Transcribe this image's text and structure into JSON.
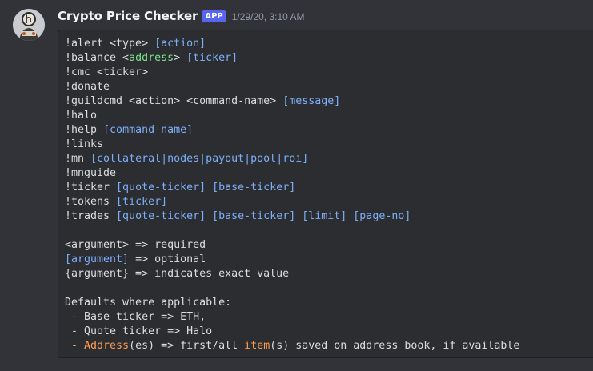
{
  "message": {
    "username": "Crypto Price Checker",
    "badge": "APP",
    "timestamp": "1/29/20, 3:10 AM",
    "avatar": "bot-avatar-icon"
  },
  "colors": {
    "background": "#313338",
    "code_background": "#2b2d31",
    "badge": "#5865f2",
    "token_blue": "#7daef7",
    "token_green": "#7ce38b",
    "token_orange": "#ff9c50"
  },
  "code_lines": [
    [
      {
        "t": "!alert <type> ",
        "c": "plain"
      },
      {
        "t": "[action]",
        "c": "blue"
      }
    ],
    [
      {
        "t": "!balance <",
        "c": "plain"
      },
      {
        "t": "address",
        "c": "green"
      },
      {
        "t": "> ",
        "c": "plain"
      },
      {
        "t": "[ticker]",
        "c": "blue"
      }
    ],
    [
      {
        "t": "!cmc <ticker>",
        "c": "plain"
      }
    ],
    [
      {
        "t": "!donate",
        "c": "plain"
      }
    ],
    [
      {
        "t": "!guildcmd <action> <command-name> ",
        "c": "plain"
      },
      {
        "t": "[message]",
        "c": "blue"
      }
    ],
    [
      {
        "t": "!halo",
        "c": "plain"
      }
    ],
    [
      {
        "t": "!help ",
        "c": "plain"
      },
      {
        "t": "[command-name]",
        "c": "blue"
      }
    ],
    [
      {
        "t": "!links",
        "c": "plain"
      }
    ],
    [
      {
        "t": "!mn ",
        "c": "plain"
      },
      {
        "t": "[collateral|nodes|payout|pool|roi]",
        "c": "blue"
      }
    ],
    [
      {
        "t": "!mnguide",
        "c": "plain"
      }
    ],
    [
      {
        "t": "!ticker ",
        "c": "plain"
      },
      {
        "t": "[quote-ticker]",
        "c": "blue"
      },
      {
        "t": " ",
        "c": "plain"
      },
      {
        "t": "[base-ticker]",
        "c": "blue"
      }
    ],
    [
      {
        "t": "!tokens ",
        "c": "plain"
      },
      {
        "t": "[ticker]",
        "c": "blue"
      }
    ],
    [
      {
        "t": "!trades ",
        "c": "plain"
      },
      {
        "t": "[quote-ticker]",
        "c": "blue"
      },
      {
        "t": " ",
        "c": "plain"
      },
      {
        "t": "[base-ticker]",
        "c": "blue"
      },
      {
        "t": " ",
        "c": "plain"
      },
      {
        "t": "[limit]",
        "c": "blue"
      },
      {
        "t": " ",
        "c": "plain"
      },
      {
        "t": "[page-no]",
        "c": "blue"
      }
    ],
    [
      {
        "t": "",
        "c": "plain"
      }
    ],
    [
      {
        "t": "<argument> => required",
        "c": "plain"
      }
    ],
    [
      {
        "t": "[argument]",
        "c": "blue"
      },
      {
        "t": " => optional",
        "c": "plain"
      }
    ],
    [
      {
        "t": "{argument} => indicates exact value",
        "c": "plain"
      }
    ],
    [
      {
        "t": "",
        "c": "plain"
      }
    ],
    [
      {
        "t": "Defaults where applicable:",
        "c": "plain"
      }
    ],
    [
      {
        "t": " - Base ticker => ETH,",
        "c": "plain"
      }
    ],
    [
      {
        "t": " - Quote ticker => Halo",
        "c": "plain"
      }
    ],
    [
      {
        "t": " - ",
        "c": "orange"
      },
      {
        "t": "Address",
        "c": "orange"
      },
      {
        "t": "(es) => first/all ",
        "c": "plain"
      },
      {
        "t": "item",
        "c": "orange"
      },
      {
        "t": "(s) saved on address book, if available",
        "c": "plain"
      }
    ]
  ]
}
